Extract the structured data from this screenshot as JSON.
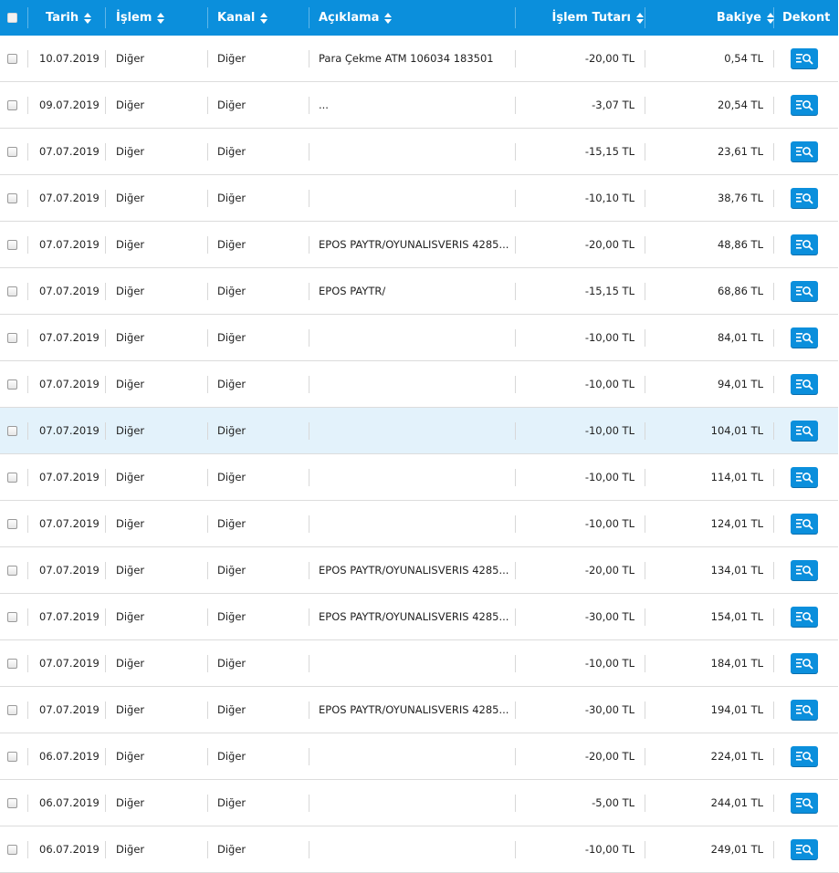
{
  "header": {
    "tarih": "Tarih",
    "islem": "İşlem",
    "kanal": "Kanal",
    "aciklama": "Açıklama",
    "islem_tutari": "İşlem Tutarı",
    "bakiye": "Bakiye",
    "dekont": "Dekont"
  },
  "colors": {
    "header_bg": "#0b8fdc",
    "negative_amount": "#e8192c",
    "row_highlight": "#e3f2fb"
  },
  "rows": [
    {
      "date": "10.07.2019",
      "islem": "Diğer",
      "kanal": "Diğer",
      "desc": "Para Çekme ATM 106034 183501",
      "amount": "-20,00 TL",
      "balance": "0,54 TL"
    },
    {
      "date": "09.07.2019",
      "islem": "Diğer",
      "kanal": "Diğer",
      "desc": "...",
      "amount": "-3,07 TL",
      "balance": "20,54 TL"
    },
    {
      "date": "07.07.2019",
      "islem": "Diğer",
      "kanal": "Diğer",
      "desc": "",
      "amount": "-15,15 TL",
      "balance": "23,61 TL"
    },
    {
      "date": "07.07.2019",
      "islem": "Diğer",
      "kanal": "Diğer",
      "desc": "",
      "amount": "-10,10 TL",
      "balance": "38,76 TL"
    },
    {
      "date": "07.07.2019",
      "islem": "Diğer",
      "kanal": "Diğer",
      "desc": "EPOS PAYTR/OYUNALISVERIS 4285...",
      "amount": "-20,00 TL",
      "balance": "48,86 TL"
    },
    {
      "date": "07.07.2019",
      "islem": "Diğer",
      "kanal": "Diğer",
      "desc": "EPOS PAYTR/",
      "amount": "-15,15 TL",
      "balance": "68,86 TL"
    },
    {
      "date": "07.07.2019",
      "islem": "Diğer",
      "kanal": "Diğer",
      "desc": "",
      "amount": "-10,00 TL",
      "balance": "84,01 TL"
    },
    {
      "date": "07.07.2019",
      "islem": "Diğer",
      "kanal": "Diğer",
      "desc": "",
      "amount": "-10,00 TL",
      "balance": "94,01 TL"
    },
    {
      "date": "07.07.2019",
      "islem": "Diğer",
      "kanal": "Diğer",
      "desc": "",
      "amount": "-10,00 TL",
      "balance": "104,01 TL",
      "highlight": true
    },
    {
      "date": "07.07.2019",
      "islem": "Diğer",
      "kanal": "Diğer",
      "desc": "",
      "amount": "-10,00 TL",
      "balance": "114,01 TL"
    },
    {
      "date": "07.07.2019",
      "islem": "Diğer",
      "kanal": "Diğer",
      "desc": "",
      "amount": "-10,00 TL",
      "balance": "124,01 TL"
    },
    {
      "date": "07.07.2019",
      "islem": "Diğer",
      "kanal": "Diğer",
      "desc": "EPOS PAYTR/OYUNALISVERIS 4285...",
      "amount": "-20,00 TL",
      "balance": "134,01 TL"
    },
    {
      "date": "07.07.2019",
      "islem": "Diğer",
      "kanal": "Diğer",
      "desc": "EPOS PAYTR/OYUNALISVERIS 4285...",
      "amount": "-30,00 TL",
      "balance": "154,01 TL"
    },
    {
      "date": "07.07.2019",
      "islem": "Diğer",
      "kanal": "Diğer",
      "desc": "",
      "amount": "-10,00 TL",
      "balance": "184,01 TL"
    },
    {
      "date": "07.07.2019",
      "islem": "Diğer",
      "kanal": "Diğer",
      "desc": "EPOS PAYTR/OYUNALISVERIS 4285...",
      "amount": "-30,00 TL",
      "balance": "194,01 TL"
    },
    {
      "date": "06.07.2019",
      "islem": "Diğer",
      "kanal": "Diğer",
      "desc": "",
      "amount": "-20,00 TL",
      "balance": "224,01 TL"
    },
    {
      "date": "06.07.2019",
      "islem": "Diğer",
      "kanal": "Diğer",
      "desc": "",
      "amount": "-5,00 TL",
      "balance": "244,01 TL"
    },
    {
      "date": "06.07.2019",
      "islem": "Diğer",
      "kanal": "Diğer",
      "desc": "",
      "amount": "-10,00 TL",
      "balance": "249,01 TL"
    }
  ]
}
